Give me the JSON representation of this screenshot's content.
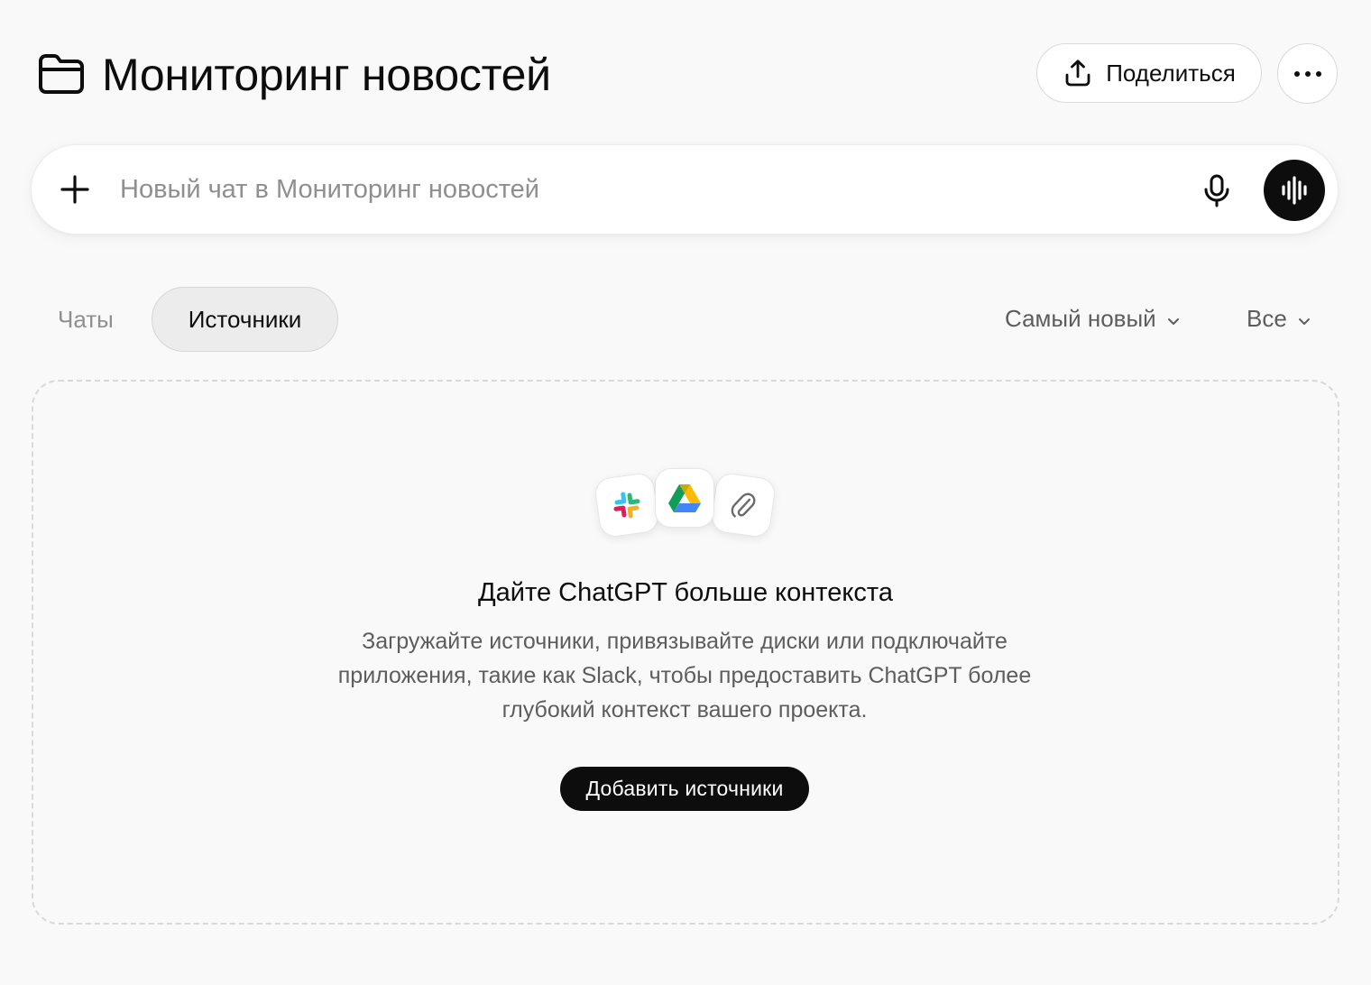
{
  "header": {
    "title": "Мониторинг новостей",
    "folder_icon": "folder-icon",
    "share_label": "Поделиться",
    "share_icon": "share-upload-icon",
    "more_icon": "more-horizontal-icon"
  },
  "composer": {
    "placeholder": "Новый чат в Мониторинг новостей",
    "value": "",
    "plus_icon": "plus-icon",
    "mic_icon": "microphone-icon",
    "voice_icon": "voice-waveform-icon"
  },
  "tabs": [
    {
      "label": "Чаты",
      "active": false
    },
    {
      "label": "Источники",
      "active": true
    }
  ],
  "sort": {
    "label": "Самый новый"
  },
  "filter": {
    "label": "Все"
  },
  "empty_state": {
    "icons": [
      "slack-icon",
      "google-drive-icon",
      "paperclip-icon"
    ],
    "title": "Дайте ChatGPT больше контекста",
    "description": "Загружайте источники, привязывайте диски или подключайте приложения, такие как Slack, чтобы предоставить ChatGPT более глубокий контекст вашего проекта.",
    "button_label": "Добавить источники"
  },
  "colors": {
    "background": "#f9f9f9",
    "primary": "#0d0d0d",
    "muted_text": "#5d5d5d",
    "placeholder": "#8f8f8f",
    "active_tab_bg": "#ececec"
  }
}
